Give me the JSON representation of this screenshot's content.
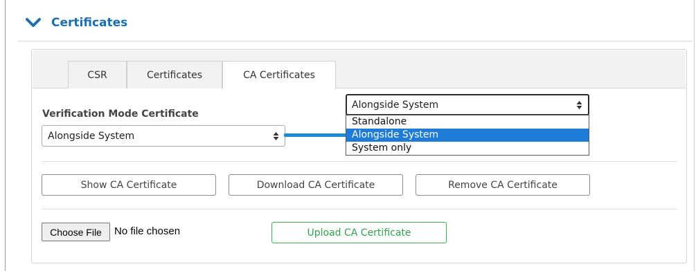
{
  "section": {
    "title": "Certificates"
  },
  "tabs": [
    {
      "label": "CSR"
    },
    {
      "label": "Certificates"
    },
    {
      "label": "CA Certificates"
    }
  ],
  "verification": {
    "label": "Verification Mode Certificate",
    "selected": "Alongside System"
  },
  "dropdown": {
    "selected": "Alongside System",
    "options": [
      "Standalone",
      "Alongside System",
      "System only"
    ]
  },
  "buttons": {
    "show": "Show CA Certificate",
    "download": "Download CA Certificate",
    "remove": "Remove CA Certificate"
  },
  "file_input": {
    "button_label": "Choose File",
    "status": "No file chosen"
  },
  "upload": {
    "label": "Upload CA Certificate"
  },
  "colors": {
    "accent_blue": "#1a6fb4",
    "selection_blue": "#1f7bd8",
    "connector_blue": "#1e8ad6",
    "upload_green": "#2ea44f"
  },
  "icons": {
    "section_toggle": "chevron-down-icon",
    "select_arrows": "select-arrows-icon"
  }
}
